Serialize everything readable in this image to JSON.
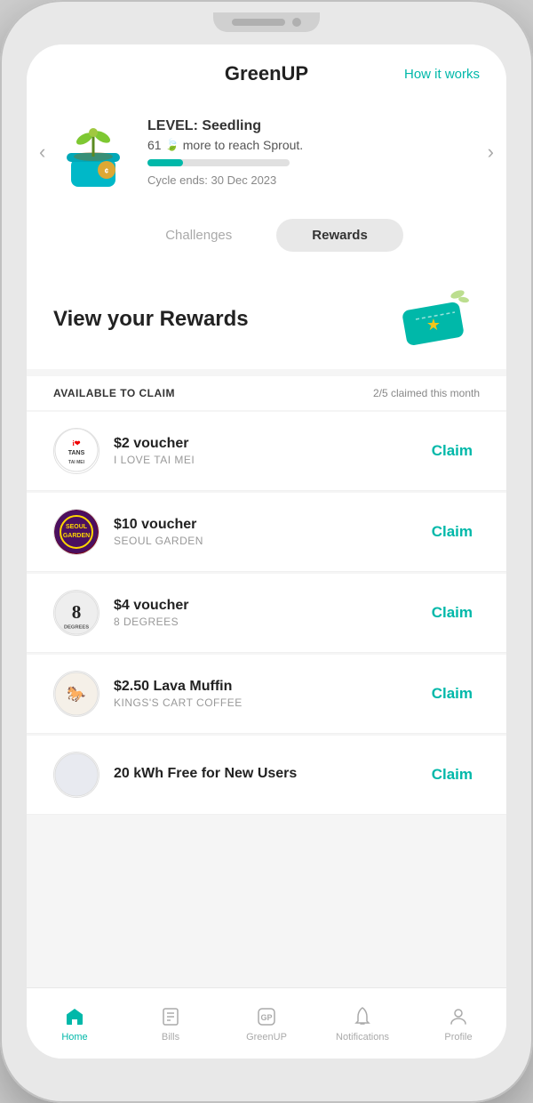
{
  "header": {
    "title": "GreenUP",
    "how_it_works": "How it works"
  },
  "level": {
    "name": "LEVEL: Seedling",
    "progress_text": "61",
    "progress_suffix": " more to reach Sprout.",
    "progress_percent": 25,
    "cycle_text": "Cycle ends: 30 Dec 2023"
  },
  "tabs": [
    {
      "label": "Challenges",
      "active": false
    },
    {
      "label": "Rewards",
      "active": true
    }
  ],
  "rewards_section": {
    "title": "View your Rewards",
    "available_label": "AVAILABLE TO CLAIM",
    "claimed_count": "2/5 claimed this month"
  },
  "rewards": [
    {
      "id": 1,
      "name": "$2 voucher",
      "brand": "I LOVE TAI MEI",
      "claim_label": "Claim",
      "logo_type": "iltm"
    },
    {
      "id": 2,
      "name": "$10 voucher",
      "brand": "SEOUL GARDEN",
      "claim_label": "Claim",
      "logo_type": "seoul"
    },
    {
      "id": 3,
      "name": "$4 voucher",
      "brand": "8 DEGREES",
      "claim_label": "Claim",
      "logo_type": "8deg"
    },
    {
      "id": 4,
      "name": "$2.50 Lava Muffin",
      "brand": "KINGS'S CART COFFEE",
      "claim_label": "Claim",
      "logo_type": "kings"
    },
    {
      "id": 5,
      "name": "20 kWh Free for New Users",
      "brand": "",
      "claim_label": "Claim",
      "logo_type": "last"
    }
  ],
  "bottom_nav": [
    {
      "label": "Home",
      "active": true,
      "icon": "home-icon"
    },
    {
      "label": "Bills",
      "active": false,
      "icon": "bills-icon"
    },
    {
      "label": "GreenUP",
      "active": false,
      "icon": "greenup-icon"
    },
    {
      "label": "Notifications",
      "active": false,
      "icon": "notifications-icon"
    },
    {
      "label": "Profile",
      "active": false,
      "icon": "profile-icon"
    }
  ],
  "colors": {
    "teal": "#00b8a9",
    "dark": "#222222",
    "gray": "#888888"
  }
}
